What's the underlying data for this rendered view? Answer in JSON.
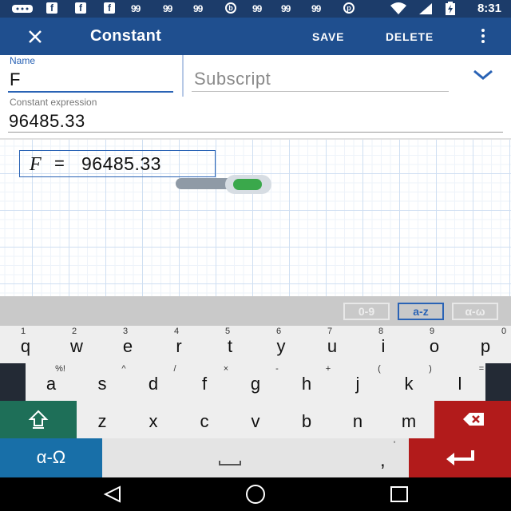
{
  "status_bar": {
    "icons": [
      "chat-icon",
      "facebook-icon",
      "facebook-icon",
      "facebook-icon",
      "99-icon",
      "99-icon",
      "99-icon",
      "b-circle-icon",
      "99-icon",
      "99-icon",
      "99-icon",
      "pinterest-icon",
      "wifi-icon",
      "sim-signal-icon",
      "battery-charging-icon"
    ],
    "badge_99": "99",
    "time": "8:31"
  },
  "toolbar": {
    "close_icon": "close-icon",
    "title": "Constant",
    "save_label": "SAVE",
    "delete_label": "DELETE",
    "more_icon": "more-vert-icon"
  },
  "form": {
    "name_label": "Name",
    "name_value": "F",
    "subscript_placeholder": "Subscript",
    "expression_label": "Constant expression",
    "expression_value": "96485.33"
  },
  "preview": {
    "variable": "F",
    "equals": "=",
    "value": "96485.33",
    "toggle_on": true
  },
  "keyboard": {
    "modes": [
      "0-9",
      "a-z",
      "α-ω"
    ],
    "active_mode": "a-z",
    "row1": [
      {
        "hint": "1",
        "key": "q"
      },
      {
        "hint": "2",
        "key": "w"
      },
      {
        "hint": "3",
        "key": "e"
      },
      {
        "hint": "4",
        "key": "r"
      },
      {
        "hint": "5",
        "key": "t"
      },
      {
        "hint": "6",
        "key": "y"
      },
      {
        "hint": "7",
        "key": "u"
      },
      {
        "hint": "8",
        "key": "i"
      },
      {
        "hint": "9",
        "key": "o"
      },
      {
        "hint": "0",
        "key": "p"
      }
    ],
    "row2": [
      {
        "hint": "%!",
        "key": "a"
      },
      {
        "hint": "^",
        "key": "s"
      },
      {
        "hint": "/",
        "key": "d"
      },
      {
        "hint": "×",
        "key": "f"
      },
      {
        "hint": "-",
        "key": "g"
      },
      {
        "hint": "+",
        "key": "h"
      },
      {
        "hint": "(",
        "key": "j"
      },
      {
        "hint": ")",
        "key": "k"
      },
      {
        "hint": "=",
        "key": "l"
      }
    ],
    "row3": [
      {
        "key": "z"
      },
      {
        "key": "x"
      },
      {
        "key": "c"
      },
      {
        "key": "v"
      },
      {
        "key": "b"
      },
      {
        "key": "n"
      },
      {
        "key": "m"
      }
    ],
    "shift_icon": "shift-icon",
    "backspace_icon": "backspace-icon",
    "alpha_label": "α-Ω",
    "space_icon": "space-icon",
    "comma_hint": "'",
    "comma_label": ",",
    "enter_icon": "enter-icon"
  },
  "nav_bar": {
    "icons": [
      "back-icon",
      "home-icon",
      "recents-icon"
    ]
  },
  "colors": {
    "status_bar": "#1c3c6a",
    "toolbar": "#1f4f8f",
    "accent": "#2a63b5",
    "toggle_on": "#3aa84b",
    "shift_key": "#1e6f58",
    "danger_key": "#b21b1b",
    "alpha_key": "#186fa8"
  }
}
